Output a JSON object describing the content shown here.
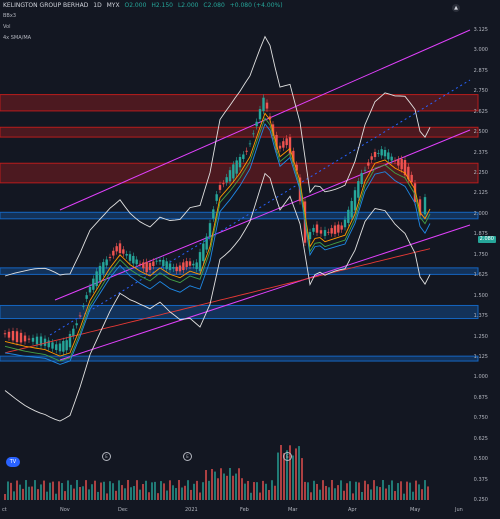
{
  "header": {
    "symbol": "KELINGTON GROUP BERHAD",
    "interval": "1D",
    "exchange": "MYX",
    "open": "O2.000",
    "high": "H2.150",
    "low": "L2.000",
    "close": "C2.080",
    "change": "+0.080 (+4.00%)",
    "indicator1": "BBx3",
    "indicator2": "Vol",
    "indicator3": "4x SMA/MA"
  },
  "last_price": "2.080",
  "colors": {
    "background": "#131722",
    "up": "#26a69a",
    "down": "#ef5350",
    "channel": "#e040fb",
    "resistance_zone": "#b71c1c",
    "support_zone": "#1565c0",
    "sma_red": "#e53935",
    "sma_blue": "#1e88e5",
    "sma_orange": "#ff9800",
    "sma_green": "#43a047",
    "bands": "#e0e0e0"
  },
  "y_axis_labels": [
    "3.125",
    "3.000",
    "2.875",
    "2.750",
    "2.625",
    "2.500",
    "2.375",
    "2.250",
    "2.125",
    "2.000",
    "1.875",
    "1.750",
    "1.625",
    "1.500",
    "1.375",
    "1.250",
    "1.125",
    "1.000",
    "0.875",
    "0.750",
    "0.625",
    "0.500",
    "0.375",
    "0.250"
  ],
  "x_axis_labels": [
    "ct",
    "Nov",
    "Dec",
    "2021",
    "Feb",
    "Mar",
    "Apr",
    "May",
    "Jun"
  ],
  "chart_data": {
    "type": "line",
    "title": "KELINGTON GROUP BERHAD, 1D, MYX",
    "xlabel": "",
    "ylabel": "",
    "ylim": [
      0.25,
      3.2
    ],
    "x": [
      "Oct",
      "Nov",
      "Dec",
      "2021",
      "Feb",
      "Mar",
      "Apr",
      "May"
    ],
    "series": [
      {
        "values": [
          1.23,
          1.18,
          1.8,
          1.68,
          2.75,
          1.85,
          2.37,
          2.08
        ]
      }
    ],
    "zones": [
      {
        "type": "resistance",
        "from": 2.63,
        "to": 2.73
      },
      {
        "type": "resistance",
        "from": 2.47,
        "to": 2.53
      },
      {
        "type": "resistance",
        "from": 2.19,
        "to": 2.31
      },
      {
        "type": "support",
        "from": 1.97,
        "to": 2.01
      },
      {
        "type": "support",
        "from": 1.63,
        "to": 1.67
      },
      {
        "type": "support",
        "from": 1.36,
        "to": 1.44
      },
      {
        "type": "support",
        "from": 1.1,
        "to": 1.13
      }
    ]
  }
}
